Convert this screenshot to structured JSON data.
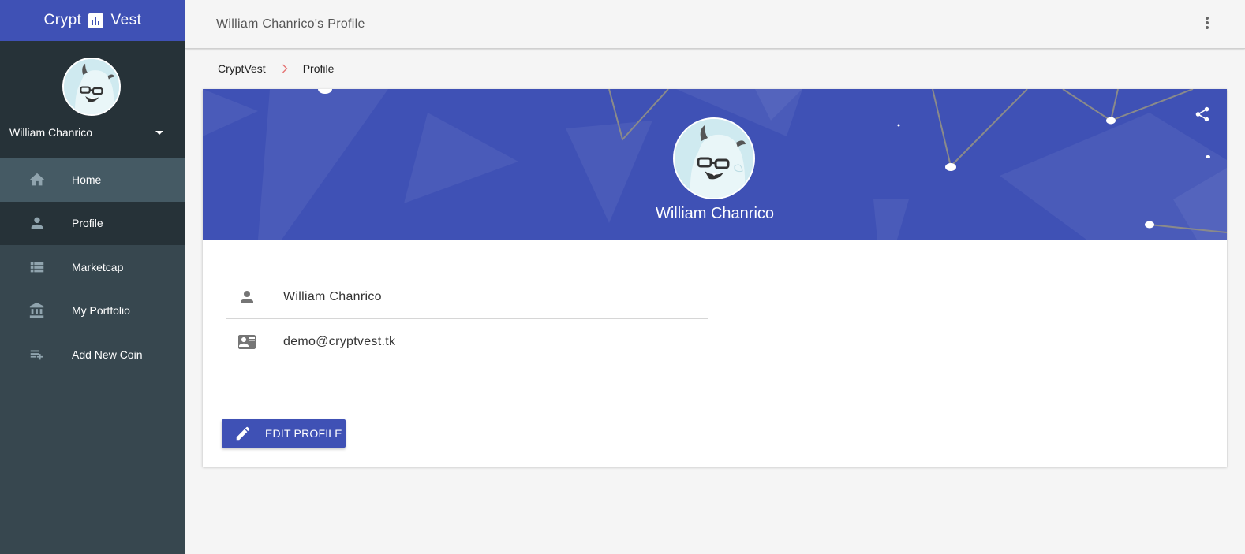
{
  "brand": {
    "name_left": "Crypt",
    "name_right": "Vest",
    "logo_icon": "bar-chart-icon",
    "color": "#3f51b5"
  },
  "sidebar": {
    "user": {
      "name": "William Chanrico",
      "avatar_icon": "yeti-avatar"
    },
    "items": [
      {
        "label": "Home",
        "icon": "home-icon",
        "state": "hover"
      },
      {
        "label": "Profile",
        "icon": "person-icon",
        "state": "active"
      },
      {
        "label": "Marketcap",
        "icon": "list-icon",
        "state": ""
      },
      {
        "label": "My Portfolio",
        "icon": "bank-icon",
        "state": ""
      },
      {
        "label": "Add New Coin",
        "icon": "playlist-add-icon",
        "state": ""
      }
    ],
    "colors": {
      "background": "#37474f",
      "active": "#263238",
      "hover": "#455a64"
    }
  },
  "header": {
    "title": "William Chanrico's Profile",
    "menu_icon": "more-vert-icon"
  },
  "breadcrumb": {
    "items": [
      "CryptVest",
      "Profile"
    ],
    "separator_icon": "chevron-right-icon"
  },
  "profile": {
    "banner_name": "William Chanrico",
    "share_icon": "share-icon",
    "fields": {
      "name": {
        "value": "William Chanrico",
        "icon": "person-icon"
      },
      "email": {
        "value": "demo@cryptvest.tk",
        "icon": "contact-mail-icon"
      }
    },
    "edit_button": {
      "label": "EDIT PROFILE",
      "icon": "pencil-icon"
    }
  }
}
